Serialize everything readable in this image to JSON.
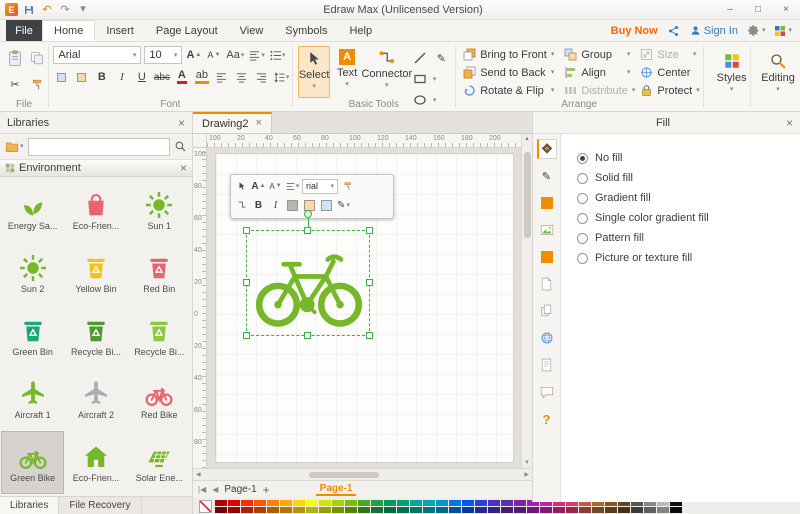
{
  "titlebar": {
    "title": "Edraw Max (Unlicensed Version)"
  },
  "window_controls": {
    "minimize": "–",
    "maximize": "□",
    "close": "×"
  },
  "menu": {
    "file_tab": "File",
    "tabs": [
      "Home",
      "Insert",
      "Page Layout",
      "View",
      "Symbols",
      "Help"
    ],
    "active_tab": "Home",
    "buy_now": "Buy Now",
    "sign_in": "Sign In"
  },
  "ribbon": {
    "section_labels": {
      "file": "File",
      "font": "Font",
      "basic_tools": "Basic Tools",
      "arrange": "Arrange"
    },
    "font": {
      "family": "Arial",
      "size": "10",
      "bold": "B",
      "italic": "I",
      "underline": "U",
      "strike": "abc",
      "case_label": "Aa",
      "color_letter": "A",
      "highlight_label": "ab",
      "grow_label": "A",
      "shrink_label": "A"
    },
    "basic_tools": {
      "select": "Select",
      "text": "Text",
      "connector": "Connector",
      "text_letter": "A"
    },
    "arrange": {
      "col1": [
        "Bring to Front",
        "Send to Back",
        "Rotate & Flip"
      ],
      "col2": [
        "Group",
        "Align",
        "Distribute"
      ],
      "col3": [
        "Size",
        "Center",
        "Protect"
      ]
    },
    "styles_label": "Styles",
    "editing_label": "Editing"
  },
  "libraries": {
    "title": "Libraries",
    "group_title": "Environment",
    "items": [
      {
        "label": "Energy Sa...",
        "type": "sprout",
        "color": "#76b82a"
      },
      {
        "label": "Eco-Frien...",
        "type": "bag",
        "color": "#e8636f"
      },
      {
        "label": "Sun 1",
        "type": "sun",
        "color": "#76b82a"
      },
      {
        "label": "Sun 2",
        "type": "sun",
        "color": "#76b82a"
      },
      {
        "label": "Yellow Bin",
        "type": "bin",
        "color": "#f0c419"
      },
      {
        "label": "Red Bin",
        "type": "bin",
        "color": "#e8636f"
      },
      {
        "label": "Green Bin",
        "type": "bin",
        "color": "#19a878"
      },
      {
        "label": "Recycle Bi...",
        "type": "bin",
        "color": "#4e9a2e"
      },
      {
        "label": "Recycle Bi...",
        "type": "bin",
        "color": "#8dc63f"
      },
      {
        "label": "Aircraft 1",
        "type": "plane",
        "color": "#76b82a"
      },
      {
        "label": "Aircraft 2",
        "type": "plane",
        "color": "#a9adb2"
      },
      {
        "label": "Red Bike",
        "type": "bike",
        "color": "#e8636f"
      },
      {
        "label": "Green Bike",
        "type": "bike",
        "color": "#76b82a",
        "selected": true
      },
      {
        "label": "Eco-Frien...",
        "type": "house",
        "color": "#76b82a"
      },
      {
        "label": "Solar Ene...",
        "type": "solar",
        "color": "#76b82a"
      }
    ],
    "bottom_tabs": [
      "Libraries",
      "File Recovery"
    ]
  },
  "canvas": {
    "doc_tab": "Drawing2",
    "h_ruler_labels": [
      "100",
      "20",
      "40",
      "60",
      "80",
      "100",
      "120",
      "140",
      "160",
      "180",
      "200"
    ],
    "v_ruler_labels": [
      "100",
      "80",
      "60",
      "40",
      "20",
      "0",
      "20",
      "40",
      "60",
      "80"
    ],
    "mini_toolbar": {
      "font": "rial"
    },
    "page_nav_tab": "Page-1",
    "add_page": "+",
    "active_page": "Page-1"
  },
  "fill_panel": {
    "title": "Fill",
    "options": [
      "No fill",
      "Solid fill",
      "Gradient fill",
      "Single color gradient fill",
      "Pattern fill",
      "Picture or texture fill"
    ],
    "selected_index": 0
  },
  "palette": {
    "columns": [
      "#b00000",
      "#e00000",
      "#ff2a00",
      "#ff5500",
      "#ff8000",
      "#ffaa00",
      "#ffd500",
      "#ffff00",
      "#d4e600",
      "#a8d400",
      "#76c000",
      "#44aa22",
      "#22a044",
      "#009955",
      "#00a077",
      "#00a899",
      "#00a8b8",
      "#0095cc",
      "#0077dd",
      "#0055ee",
      "#2a3fd4",
      "#4433c0",
      "#5e2ab0",
      "#7a22b0",
      "#9922bb",
      "#bb22aa",
      "#d42a88",
      "#e83366",
      "#cc5544",
      "#aa6633",
      "#885522",
      "#664422",
      "#555555",
      "#888888",
      "#bbbbbb",
      "#111111"
    ]
  },
  "colors": {
    "accent_orange": "#f08c00",
    "buy_now_orange": "#ff6600",
    "shape_green": "#76b82a",
    "selection_green": "#3fae49",
    "link_blue": "#2f7bbf",
    "file_tab_bg": "#3f4246"
  }
}
